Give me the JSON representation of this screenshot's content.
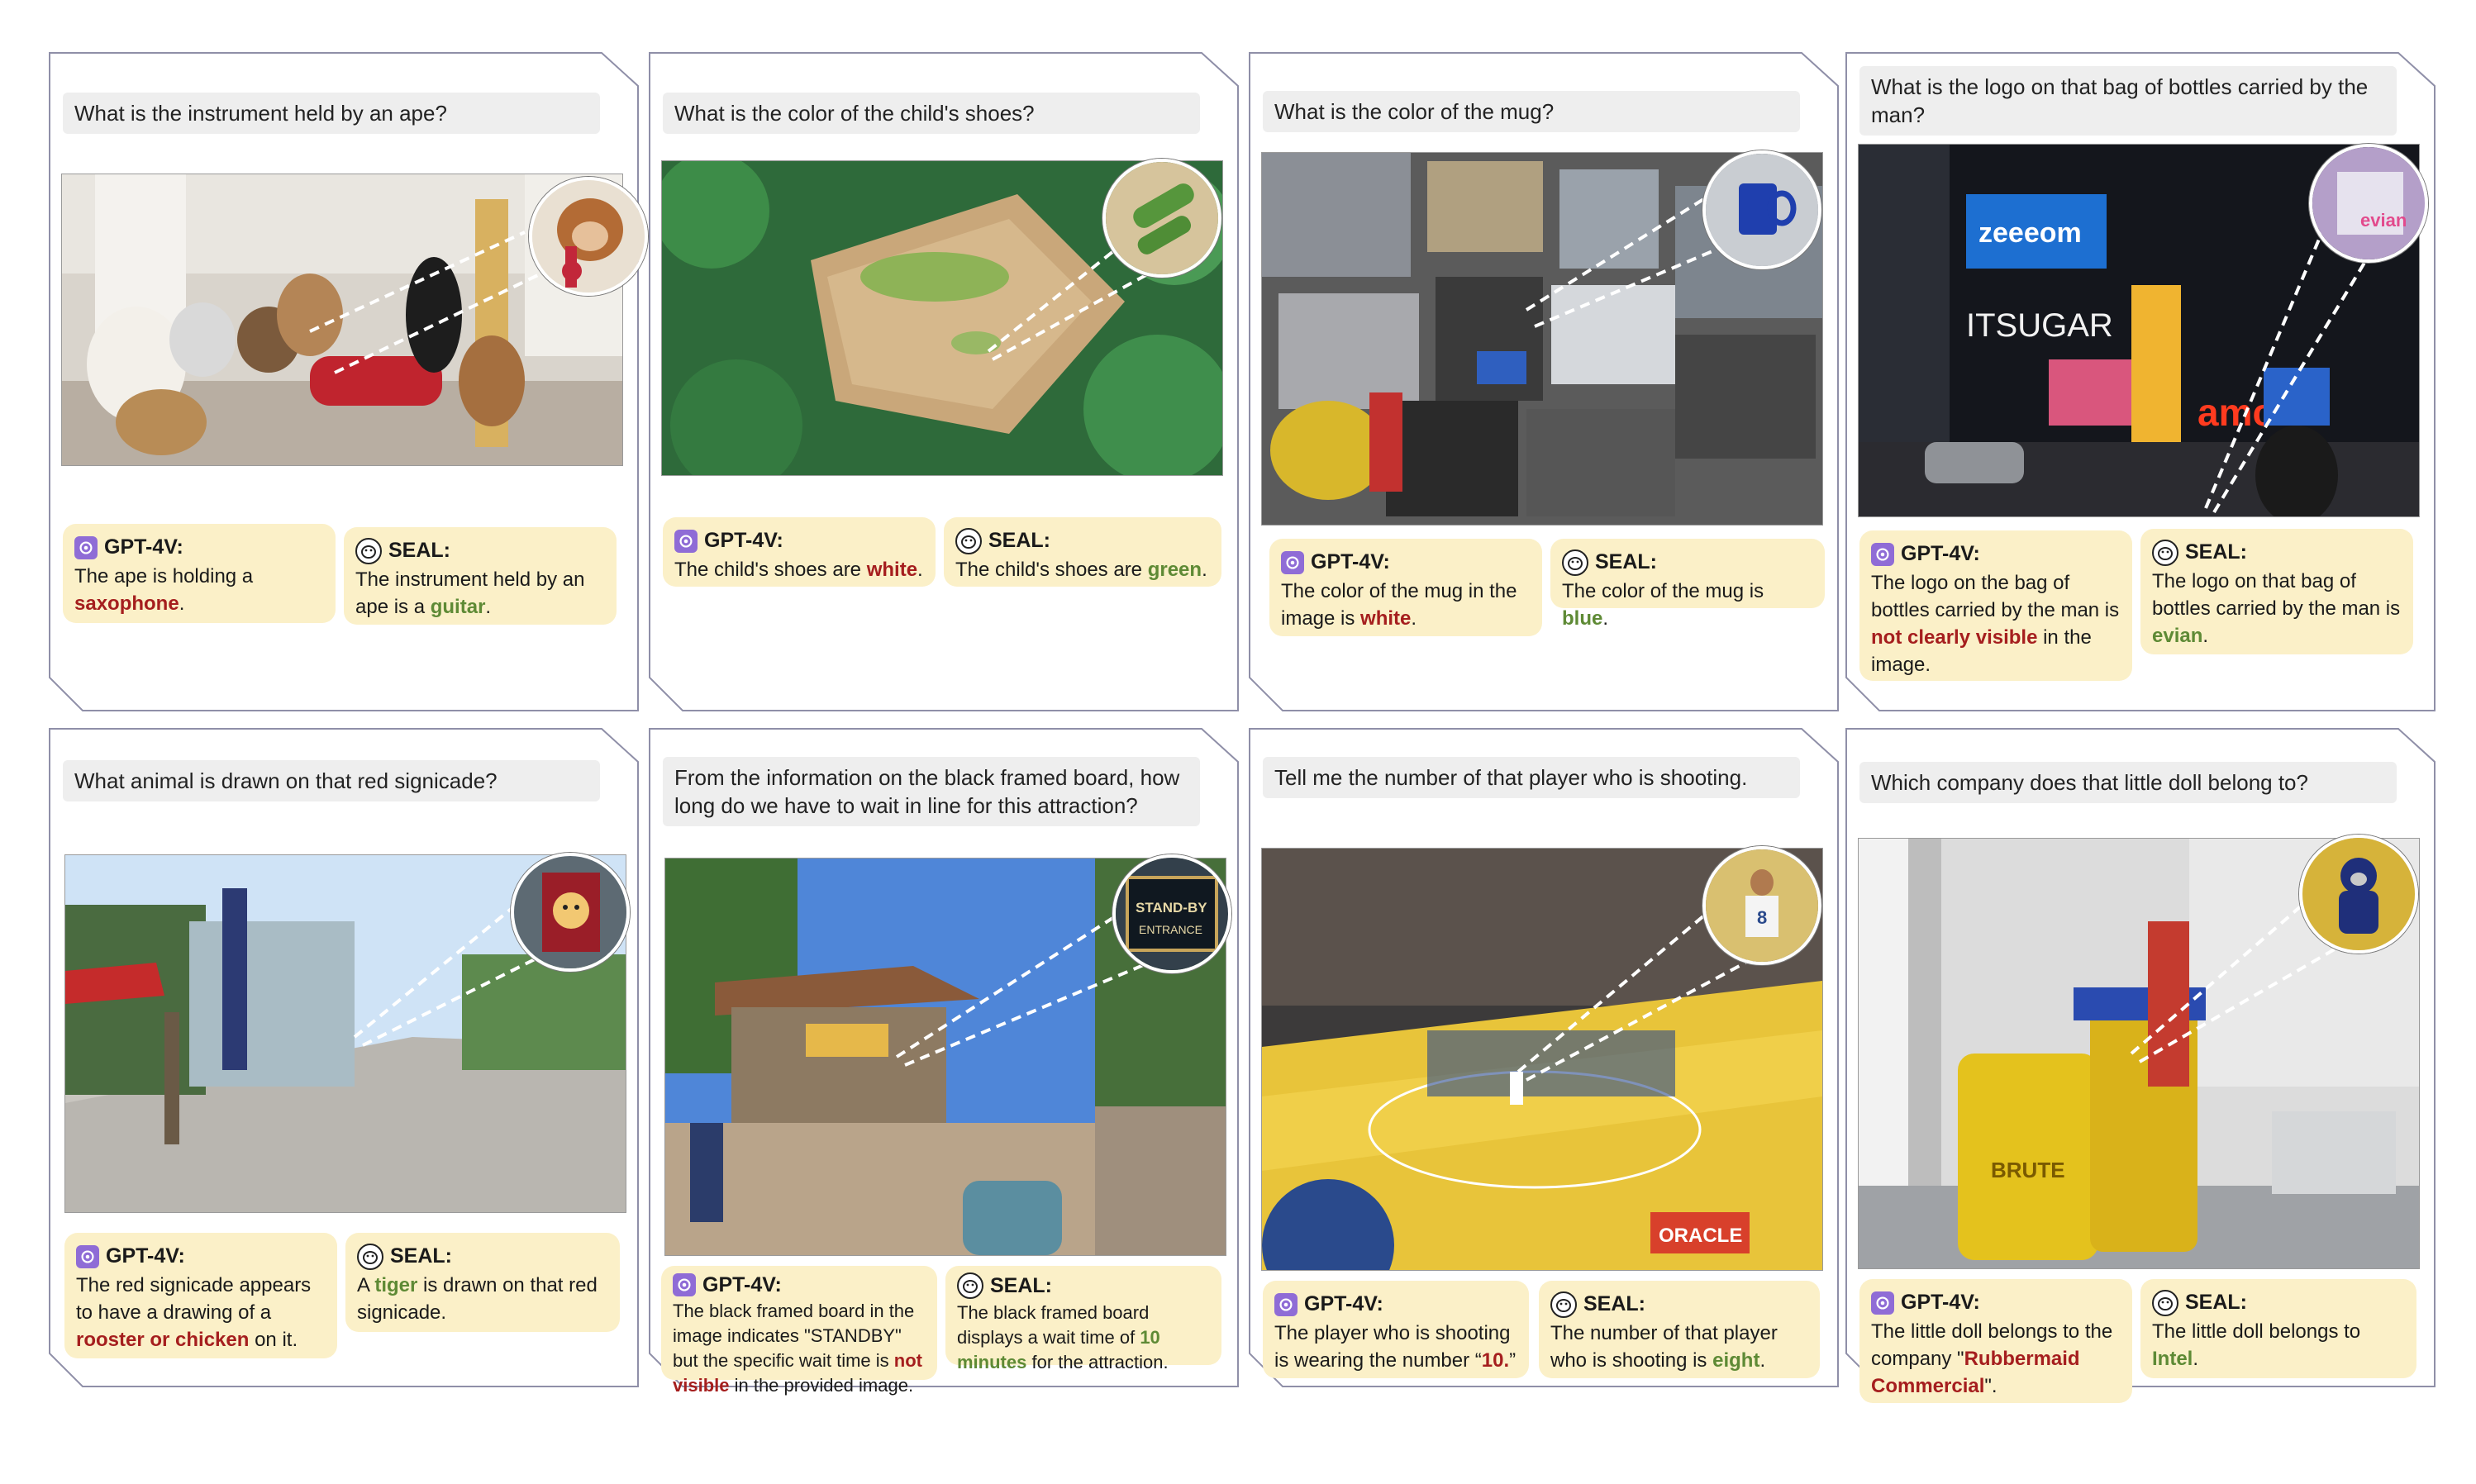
{
  "panels": [
    {
      "question": "What is the instrument held by an ape?",
      "gpt": {
        "title": "GPT-4V:",
        "pre": "The ape is holding a ",
        "hl": "saxophone",
        "post": "."
      },
      "seal": {
        "title": "SEAL:",
        "pre": "The instrument held by an ape is a ",
        "hl": "guitar",
        "post": "."
      }
    },
    {
      "question": "What is the color of the child's shoes?",
      "gpt": {
        "title": "GPT-4V:",
        "pre": "The child's shoes are ",
        "hl": "white",
        "post": "."
      },
      "seal": {
        "title": "SEAL:",
        "pre": "The child's shoes are ",
        "hl": "green",
        "post": "."
      }
    },
    {
      "question": "What is the color of the mug?",
      "gpt": {
        "title": "GPT-4V:",
        "pre": "The color of the mug in the image is ",
        "hl": "white",
        "post": "."
      },
      "seal": {
        "title": "SEAL:",
        "pre": "The color of the mug is ",
        "hl": "blue",
        "post": "."
      }
    },
    {
      "question": "What is the logo on that bag of bottles carried by the man?",
      "gpt": {
        "title": "GPT-4V:",
        "pre": "The logo on the bag of bottles carried by the man is ",
        "hl": "not clearly visible",
        "post": " in the image."
      },
      "seal": {
        "title": "SEAL:",
        "pre": "The logo on that bag of bottles carried by the man is ",
        "hl": "evian",
        "post": "."
      }
    },
    {
      "question": "What animal is drawn on that red signicade?",
      "gpt": {
        "title": "GPT-4V:",
        "pre": "The red signicade appears to have a drawing of a ",
        "hl": "rooster or chicken",
        "post": " on it."
      },
      "seal": {
        "title": "SEAL:",
        "pre": "A ",
        "hl": "tiger",
        "post": " is drawn on that red signicade."
      }
    },
    {
      "question": "From the information on the black framed board, how long do we have to wait in line for this attraction?",
      "gpt": {
        "title": "GPT-4V:",
        "pre": "The black framed board in the image indicates \"STANDBY\" but the specific wait time is ",
        "hl": "not visible",
        "post": " in the provided image."
      },
      "seal": {
        "title": "SEAL:",
        "pre": "The black framed board displays a wait time of ",
        "hl": "10 minutes",
        "post": " for the attraction."
      }
    },
    {
      "question": "Tell me the number of that player who is shooting.",
      "gpt": {
        "title": "GPT-4V:",
        "pre": "The player who is shooting is wearing the number “",
        "hl": "10.",
        "post": "”"
      },
      "seal": {
        "title": "SEAL:",
        "pre": "The number of that player who is shooting is ",
        "hl": "eight",
        "post": "."
      }
    },
    {
      "question": "Which company does that little doll belong to?",
      "gpt": {
        "title": "GPT-4V:",
        "pre": "The little doll belongs to the company \"",
        "hl": "Rubbermaid Commercial",
        "post": "\"."
      },
      "seal": {
        "title": "SEAL:",
        "pre": "The little doll belongs to ",
        "hl": "Intel",
        "post": "."
      }
    }
  ],
  "photo_text": {
    "zeeg": "zeeeom",
    "itsugar": "ITSUGAR",
    "amc": "amc",
    "evian": "evian",
    "standby": "STAND-BY",
    "entrance": "ENTRANCE",
    "brute": "BRUTE",
    "oracle": "ORACLE"
  },
  "colors": {
    "wrong": "#a51e1e",
    "right": "#5e8a35",
    "answer_bg": "#fbf0c8",
    "question_bg": "#eeeeee",
    "gpt_icon": "#8f6cd6"
  }
}
